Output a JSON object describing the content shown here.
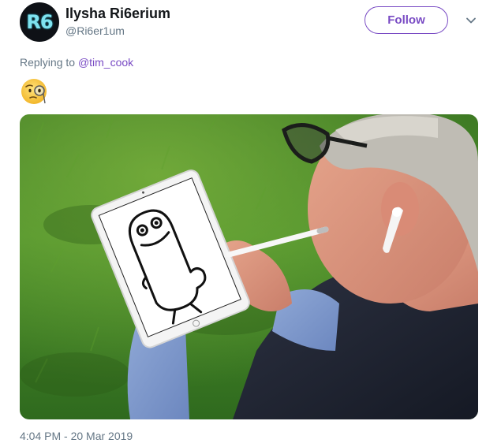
{
  "user": {
    "avatar_text": "R6",
    "display_name": "Ilysha Ri6erium",
    "handle": "@Ri6er1um"
  },
  "actions": {
    "follow_label": "Follow"
  },
  "reply": {
    "prefix": "Replying to",
    "mention": "@tim_cook"
  },
  "tweet": {
    "emoji_icon": "face-with-monocle-icon",
    "media_icon": "photo-man-drawing-on-tablet",
    "timestamp": "4:04 PM - 20 Mar 2019"
  },
  "colors": {
    "accent": "#794bc4",
    "secondary_text": "#657786",
    "primary_text": "#14171a"
  }
}
